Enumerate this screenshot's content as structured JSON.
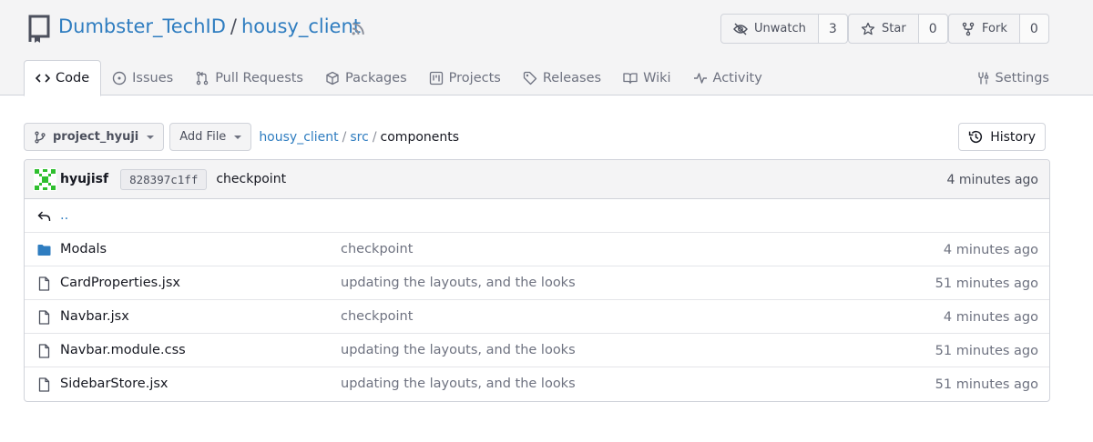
{
  "repo": {
    "owner": "Dumbster_TechID",
    "separator": "/",
    "name": "housy_client"
  },
  "actions": {
    "watch": {
      "label": "Unwatch",
      "count": "3"
    },
    "star": {
      "label": "Star",
      "count": "0"
    },
    "fork": {
      "label": "Fork",
      "count": "0"
    }
  },
  "tabs": [
    {
      "label": "Code",
      "icon": "code-icon",
      "active": true
    },
    {
      "label": "Issues",
      "icon": "issue-icon"
    },
    {
      "label": "Pull Requests",
      "icon": "pull-request-icon"
    },
    {
      "label": "Packages",
      "icon": "package-icon"
    },
    {
      "label": "Projects",
      "icon": "project-icon"
    },
    {
      "label": "Releases",
      "icon": "tag-icon"
    },
    {
      "label": "Wiki",
      "icon": "book-icon"
    },
    {
      "label": "Activity",
      "icon": "pulse-icon"
    }
  ],
  "settings_tab": {
    "label": "Settings",
    "icon": "tools-icon"
  },
  "toolbar": {
    "branch": "project_hyuji",
    "add_file": "Add File",
    "breadcrumb": [
      "housy_client",
      "src",
      "components"
    ],
    "history": "History"
  },
  "latest_commit": {
    "author": "hyujisf",
    "sha": "828397c1ff",
    "message": "checkpoint",
    "time": "4 minutes ago"
  },
  "parent_dir": "..",
  "files": [
    {
      "name": "Modals",
      "type": "folder",
      "message": "checkpoint",
      "time": "4 minutes ago"
    },
    {
      "name": "CardProperties.jsx",
      "type": "file",
      "message": "updating the layouts, and the looks",
      "time": "51 minutes ago"
    },
    {
      "name": "Navbar.jsx",
      "type": "file",
      "message": "checkpoint",
      "time": "4 minutes ago"
    },
    {
      "name": "Navbar.module.css",
      "type": "file",
      "message": "updating the layouts, and the looks",
      "time": "51 minutes ago"
    },
    {
      "name": "SidebarStore.jsx",
      "type": "file",
      "message": "updating the layouts, and the looks",
      "time": "51 minutes ago"
    }
  ],
  "colors": {
    "link": "#2f7dc0",
    "folder": "#2f7dc0",
    "avatar": "#2fbf2f"
  }
}
